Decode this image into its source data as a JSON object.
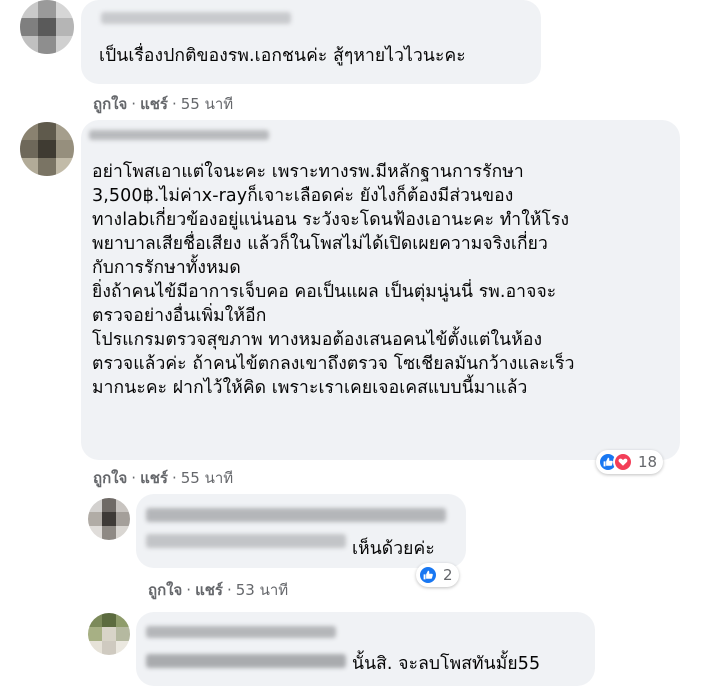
{
  "comments": [
    {
      "text": "เป็นเรื่องปกติของรพ.เอกชนค่ะ สู้ๆหายไวไวนะคะ",
      "like": "ถูกใจ",
      "reply": "แชร์",
      "time": "55 นาที"
    },
    {
      "text": "อย่าโพสเอาแต่ใจนะคะ เพราะทางรพ.มีหลักฐานการรักษา\n3,500฿.ไม่ค่าx-rayก็เจาะเลือดค่ะ ยังไงก็ต้องมีส่วนของ\nทางlabเกี่ยวข้องอยู่แน่นอน ระวังจะโดนฟ้องเอานะคะ ทำให้โรง\nพยาบาลเสียชื่อเสียง แล้วก็ในโพสไม่ได้เปิดเผยความจริงเกี่ยว\nกับการรักษาทั้งหมด\nยิ่งถ้าคนไข้มีอาการเจ็บคอ คอเป็นแผล เป็นตุ่มนู่นนี่ รพ.อาจจะ\nตรวจอย่างอื่นเพิ่มให้อีก\nโปรแกรมตรวจสุขภาพ ทางหมอต้องเสนอคนไข้ตั้งแต่ในห้อง\nตรวจแล้วค่ะ ถ้าคนไข้ตกลงเขาถึงตรวจ โซเชียลมันกว้างและเร็ว\nมากนะคะ ฝากไว้ให้คิด เพราะเราเคยเจอเคสแบบนี้มาแล้ว",
      "like": "ถูกใจ",
      "reply": "แชร์",
      "time": "55 นาที",
      "reaction_count": "18",
      "reaction_icons": [
        "like-icon",
        "love-icon"
      ]
    },
    {
      "text": "เห็นด้วยค่ะ",
      "like": "ถูกใจ",
      "reply": "แชร์",
      "time": "53 นาที",
      "reaction_count": "2",
      "reaction_icons": [
        "like-icon"
      ]
    },
    {
      "text": "นั้นสิ. จะลบโพสทันมั้ย55"
    }
  ],
  "colors": {
    "bubble": "#f0f2f5",
    "meta": "#65676b",
    "like": "#1877f2",
    "love": "#f33e58"
  }
}
